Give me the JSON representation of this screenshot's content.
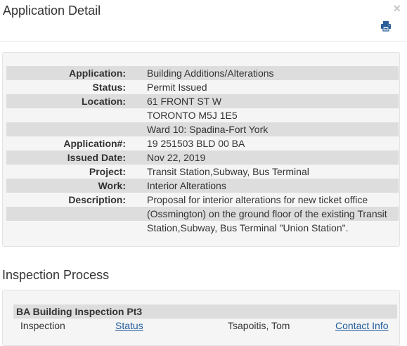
{
  "modal": {
    "title": "Application Detail",
    "close_label": "×"
  },
  "details": [
    {
      "label": "Application:",
      "lines": [
        "Building Additions/Alterations"
      ]
    },
    {
      "label": "Status:",
      "lines": [
        "Permit Issued"
      ]
    },
    {
      "label": "Location:",
      "lines": [
        "61 FRONT ST W",
        "TORONTO M5J 1E5",
        "Ward 10: Spadina-Fort York"
      ]
    },
    {
      "label": "Application#:",
      "lines": [
        "19 251503 BLD 00 BA"
      ]
    },
    {
      "label": "Issued Date:",
      "lines": [
        "Nov 22, 2019"
      ]
    },
    {
      "label": "Project:",
      "lines": [
        "Transit Station,Subway, Bus Terminal"
      ]
    },
    {
      "label": "Work:",
      "lines": [
        "Interior Alterations"
      ]
    },
    {
      "label": "Description:",
      "lines": [
        "Proposal for interior alterations for new ticket office",
        "(Ossmington) on the ground floor of the existing Transit",
        "Station,Subway, Bus Terminal \"Union Station\"."
      ]
    }
  ],
  "inspection": {
    "section_title": "Inspection Process",
    "group_title": "BA Building Inspection Pt3",
    "columns": {
      "inspection": "Inspection",
      "status": "Status",
      "inspector": "Tsapoitis, Tom",
      "contact": "Contact Info"
    }
  },
  "colors": {
    "link": "#1f5a9a",
    "row_shade": "#dddddd",
    "panel_bg": "#f5f5f5"
  },
  "icons": {
    "print": "printer-icon",
    "close": "close-icon"
  }
}
